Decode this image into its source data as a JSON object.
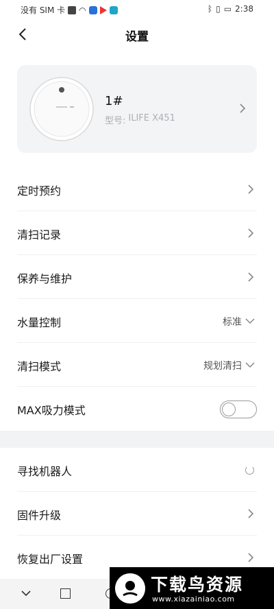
{
  "status_bar": {
    "carrier": "没有 SIM 卡",
    "time": "2:38",
    "left_icons": [
      "notification-icon",
      "wifi-icon",
      "app-icon-blue",
      "play-icon",
      "app-icon-teal"
    ],
    "right_icons": [
      "bluetooth-icon",
      "vibrate-icon",
      "battery-icon"
    ]
  },
  "header": {
    "title": "设置",
    "back_icon": "chevron-left-icon"
  },
  "device": {
    "name": "1#",
    "model_label": "型号:",
    "model_value": "ILIFE X451"
  },
  "settings": {
    "schedule": "定时预约",
    "history": "清扫记录",
    "maintenance": "保养与维护",
    "water_control": {
      "label": "水量控制",
      "value": "标准"
    },
    "clean_mode": {
      "label": "清扫模式",
      "value": "规划清扫"
    },
    "max_suction": {
      "label": "MAX吸力模式",
      "enabled": false
    }
  },
  "settings2": {
    "find_robot": "寻找机器人",
    "firmware": "固件升级",
    "factory_reset": "恢复出厂设置"
  },
  "watermark": {
    "title": "下载鸟资源",
    "url": "www.xiazainiao.com"
  },
  "colors": {
    "card_bg": "#f3f4f6",
    "divider_bg": "#f2f3f5",
    "text": "#1a1a1a",
    "muted": "#aab0b6"
  }
}
